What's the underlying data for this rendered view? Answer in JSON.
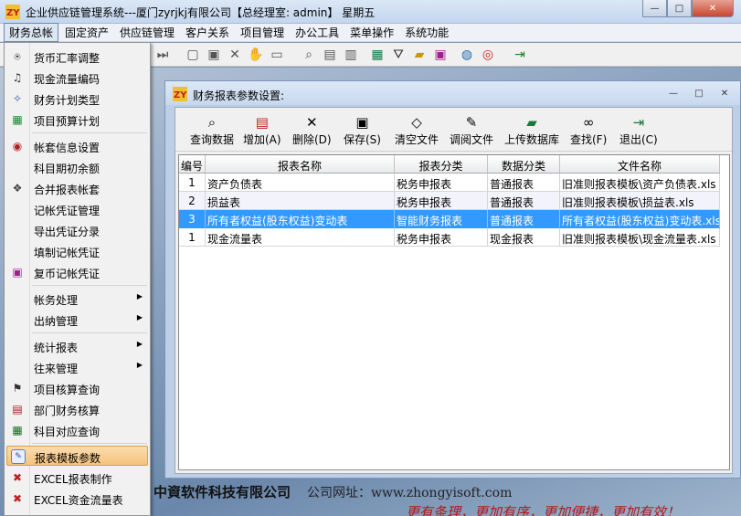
{
  "window": {
    "title": "企业供应链管理系统---厦门zyrjkj有限公司【总经理室: admin】 星期五",
    "controls": {
      "minimize": "—",
      "maximize": "□",
      "close": "✕"
    }
  },
  "menubar": {
    "items": [
      "财务总帐",
      "固定资产",
      "供应链管理",
      "客户关系",
      "项目管理",
      "办公工具",
      "菜单操作",
      "系统功能"
    ]
  },
  "dropdown": {
    "items": [
      {
        "label": "货币汇率调整",
        "icon": "currency-icon",
        "glyph": "ᵹ"
      },
      {
        "label": "现金流量编码",
        "icon": "cashflow-icon",
        "glyph": "♫"
      },
      {
        "label": "财务计划类型",
        "icon": "plan-type-icon",
        "glyph": "✧"
      },
      {
        "label": "项目预算计划",
        "icon": "budget-icon",
        "glyph": "▦"
      },
      {
        "label": "帐套信息设置",
        "icon": "account-set-icon",
        "glyph": "◉"
      },
      {
        "label": "科目期初余额",
        "icon": "",
        "glyph": ""
      },
      {
        "label": "合并报表帐套",
        "icon": "merge-icon",
        "glyph": "❖"
      },
      {
        "label": "记帐凭证管理",
        "icon": "",
        "glyph": ""
      },
      {
        "label": "导出凭证分录",
        "icon": "",
        "glyph": ""
      },
      {
        "label": "填制记帐凭证",
        "icon": "",
        "glyph": ""
      },
      {
        "label": "复币记帐凭证",
        "icon": "foreign-voucher-icon",
        "glyph": "▣"
      },
      {
        "label": "帐务处理",
        "icon": "",
        "glyph": "",
        "submenu": true
      },
      {
        "label": "出纳管理",
        "icon": "",
        "glyph": "",
        "submenu": true
      },
      {
        "label": "统计报表",
        "icon": "",
        "glyph": "",
        "submenu": true
      },
      {
        "label": "往来管理",
        "icon": "",
        "glyph": "",
        "submenu": true
      },
      {
        "label": "项目核算查询",
        "icon": "project-query-icon",
        "glyph": "⚑"
      },
      {
        "label": "部门财务核算",
        "icon": "department-icon",
        "glyph": "▤"
      },
      {
        "label": "科目对应查询",
        "icon": "grid-icon",
        "glyph": "▦"
      },
      {
        "label": "报表模板参数",
        "icon": "edit-icon",
        "glyph": "✎"
      },
      {
        "label": "EXCEL报表制作",
        "icon": "excel-icon",
        "glyph": "✖"
      },
      {
        "label": "EXCEL资金流量表",
        "icon": "excel-icon",
        "glyph": "✖"
      }
    ]
  },
  "child_window": {
    "title": "财务报表参数设置:",
    "toolbar": [
      {
        "label": "查询数据",
        "icon": "search-icon",
        "glyph": "⌕"
      },
      {
        "label": "增加(A)",
        "icon": "add-icon",
        "glyph": "▤"
      },
      {
        "label": "删除(D)",
        "icon": "delete-icon",
        "glyph": "✕"
      },
      {
        "label": "保存(S)",
        "icon": "save-icon",
        "glyph": "▣"
      },
      {
        "label": "清空文件",
        "icon": "eraser-icon",
        "glyph": "◇"
      },
      {
        "label": "调阅文件",
        "icon": "open-file-icon",
        "glyph": "✎"
      },
      {
        "label": "上传数据库",
        "icon": "upload-icon",
        "glyph": "▰"
      },
      {
        "label": "查找(F)",
        "icon": "binoculars-icon",
        "glyph": "∞"
      },
      {
        "label": "退出(C)",
        "icon": "exit-icon",
        "glyph": "⇥"
      }
    ],
    "grid": {
      "headers": [
        "编号",
        "报表名称",
        "报表分类",
        "数据分类",
        "文件名称"
      ],
      "rows": [
        [
          "1",
          "资产负债表",
          "税务申报表",
          "普通报表",
          "旧准则报表模板\\资产负债表.xls"
        ],
        [
          "2",
          "损益表",
          "税务申报表",
          "普通报表",
          "旧准则报表模板\\损益表.xls"
        ],
        [
          "3",
          "所有者权益(股东权益)变动表",
          "智能财务报表",
          "普通报表",
          "所有者权益(股东权益)变动表.xls"
        ],
        [
          "1",
          "现金流量表",
          "税务申报表",
          "现金报表",
          "旧准则报表模板\\现金流量表.xls"
        ]
      ]
    }
  },
  "background": {
    "company": "中資软件科技有限公司",
    "website": "公司网址：www.zhongyisoft.com",
    "slogan": "更有条理，更加有序，更加便捷，更加有效！"
  },
  "colors": {
    "selection": "#3399ff",
    "menu_highlight": "#f6c880",
    "desktop": "#7f97b4"
  }
}
